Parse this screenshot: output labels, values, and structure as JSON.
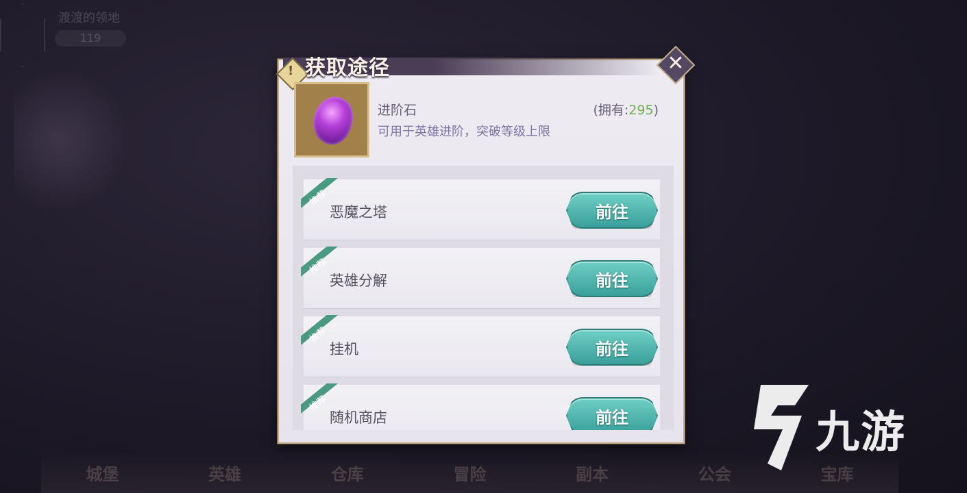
{
  "background": {
    "player_name": "渡渡的领地",
    "player_power": "119",
    "bottom_nav": [
      "城堡",
      "英雄",
      "仓库",
      "冒险",
      "副本",
      "公会",
      "宝库"
    ]
  },
  "dialog": {
    "title": "获取途径",
    "item": {
      "name": "进阶石",
      "description": "可用于英雄进阶，突破等级上限",
      "owned_prefix": "(拥有:",
      "owned_count": "295",
      "owned_suffix": ")",
      "icon": "purple-gem-icon"
    },
    "sources": [
      {
        "tag": "推荐",
        "name": "恶魔之塔",
        "button": "前往"
      },
      {
        "tag": "推荐",
        "name": "英雄分解",
        "button": "前往"
      },
      {
        "tag": "推荐",
        "name": "挂机",
        "button": "前往"
      },
      {
        "tag": "推荐",
        "name": "随机商店",
        "button": "前往"
      }
    ]
  },
  "watermark": {
    "text": "九游"
  },
  "colors": {
    "accent_teal": "#3a9f9a",
    "owned_green": "#6cae52",
    "title_bar": "#4a3d56"
  }
}
